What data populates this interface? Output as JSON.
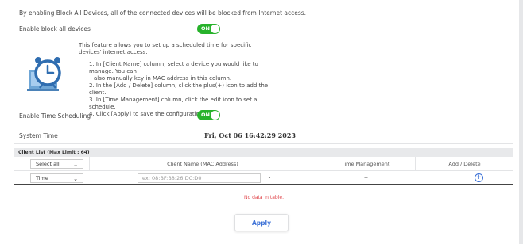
{
  "notice": "By enabling Block All Devices, all of the connected devices will be blocked from Internet access.",
  "block_all": {
    "label": "Enable block all devices",
    "toggle": "ON",
    "state": "on"
  },
  "feature": {
    "intro": "This feature allows you to set up a scheduled time for specific devices' internet access.",
    "steps": [
      "1. In [Client Name] column, select a device you would like to manage. You can",
      "also manually key in MAC address in this column.",
      "2. In the [Add / Delete] column, click the plus(+) icon to add the client.",
      "3. In [Time Management] column, click the edit icon to set a schedule.",
      "4. Click [Apply] to save the configurations."
    ],
    "illustration_icon": "alarm-clock-laptop-icon"
  },
  "time_scheduling": {
    "label": "Enable Time Scheduling",
    "toggle": "ON",
    "state": "on"
  },
  "system_time": {
    "label": "System Time",
    "value": "Fri, Oct 06 16:42:29 2023"
  },
  "client_list": {
    "title": "Client List (Max Limit : 64)",
    "filter_select": "Select all",
    "columns": [
      "Client Name (MAC Address)",
      "Time Management",
      "Add / Delete"
    ],
    "input_row": {
      "type_select": "Time",
      "mac_placeholder": "ex: 08:BF:B8:26:DC:D0",
      "time_management": "--"
    },
    "empty_message": "No data in table."
  },
  "apply_label": "Apply",
  "colors": {
    "toggle_on": "#27b22b",
    "accent": "#3b70d6",
    "error": "#e0474c"
  }
}
